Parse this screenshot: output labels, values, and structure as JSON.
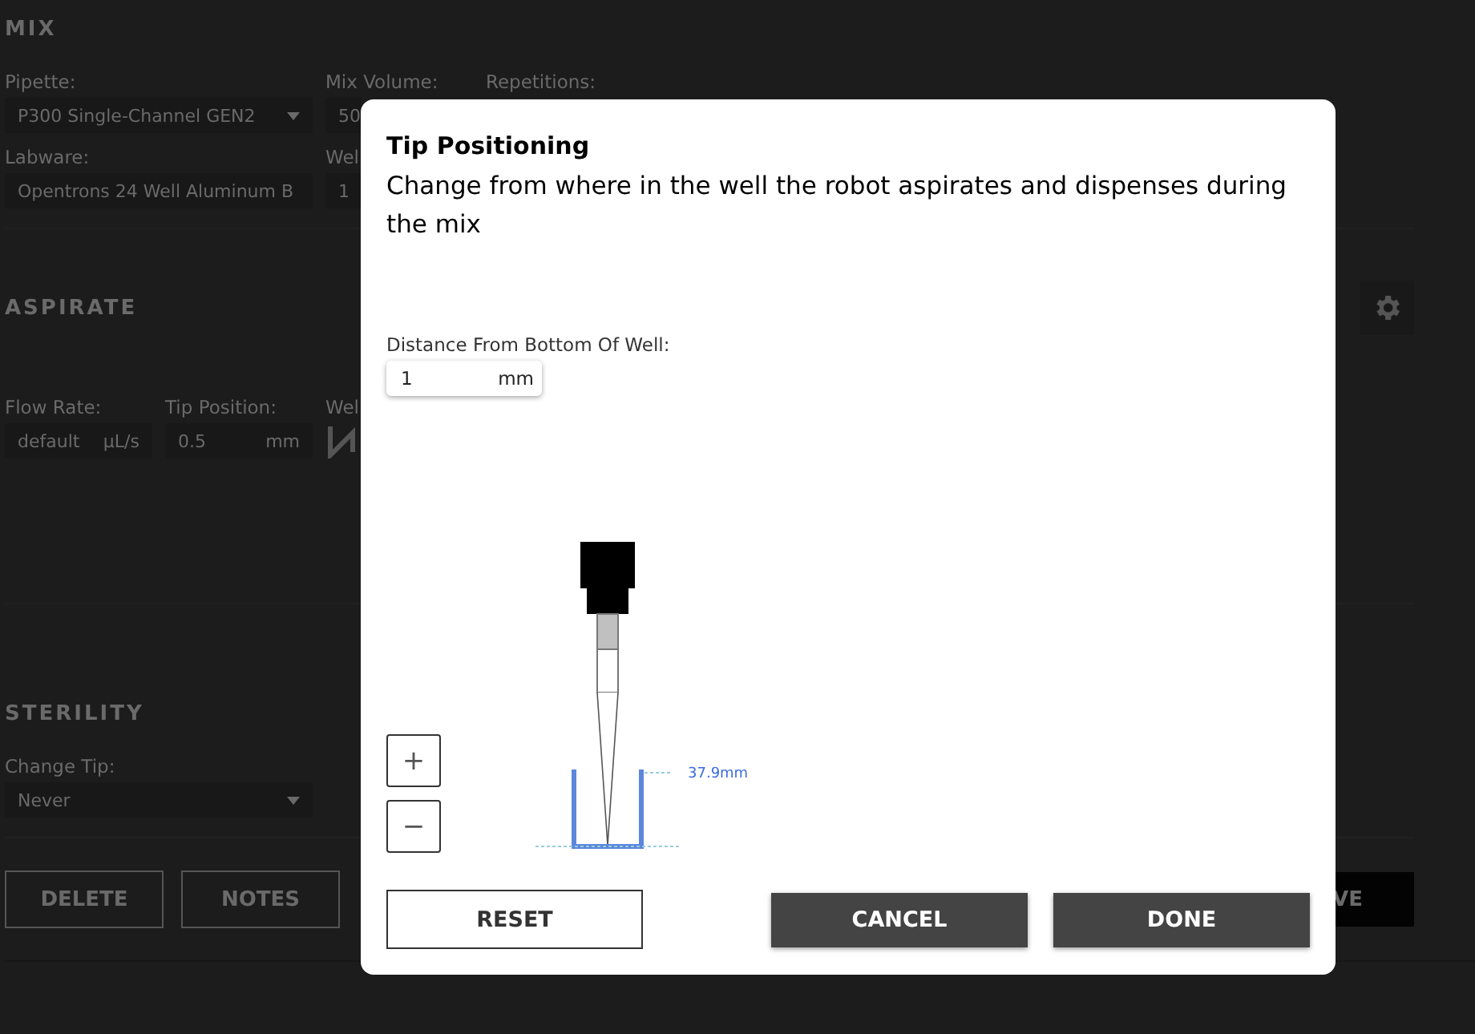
{
  "form": {
    "sections": [
      {
        "title": "MIX",
        "rows": [
          [
            {
              "label": "Pipette:",
              "value": "P300 Single-Channel GEN2",
              "kind": "dropdown"
            },
            {
              "label": "Mix Volume:",
              "value": "50",
              "kind": "text"
            },
            {
              "label": "Repetitions:",
              "kind": "label"
            }
          ],
          [
            {
              "label": "Labware:",
              "value": "Opentrons 24 Well Aluminum B",
              "kind": "text"
            },
            {
              "label": "Wel",
              "value": "1",
              "kind": "text"
            }
          ]
        ]
      },
      {
        "title": "ASPIRATE",
        "settings": true,
        "rows": [
          [
            {
              "label": "Flow Rate:",
              "value": "default",
              "unit": "µL/s",
              "kind": "text"
            },
            {
              "label": "Tip Position:",
              "value": "0.5",
              "unit": "mm",
              "kind": "text"
            },
            {
              "label": "Wel",
              "kind": "icon"
            }
          ]
        ]
      },
      {
        "title": "STERILITY",
        "rows": [
          [
            {
              "label": "Change Tip:",
              "value": "Never",
              "kind": "dropdown"
            }
          ]
        ]
      }
    ],
    "buttons": [
      "DELETE",
      "NOTES"
    ],
    "save_button": "VE"
  },
  "dialog": {
    "title": "Tip Positioning",
    "description": "Change from where in the well the robot aspirates and dispenses during the mix",
    "field": {
      "label": "Distance From Bottom Of Well:",
      "value": "1",
      "unit": "mm"
    },
    "step_buttons": [
      {
        "label": "+"
      },
      {
        "label": "−"
      }
    ],
    "well_depth": "37.9mm",
    "reset": "RESET",
    "cancel": "CANCEL",
    "done": "DONE"
  }
}
